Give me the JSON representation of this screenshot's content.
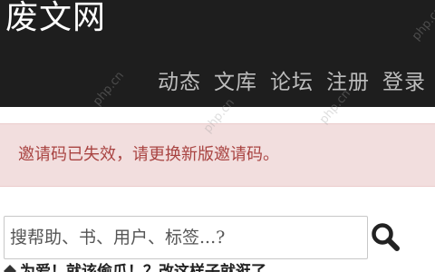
{
  "header": {
    "site_title": "废文网",
    "nav": [
      {
        "label": "动态"
      },
      {
        "label": "文库"
      },
      {
        "label": "论坛"
      },
      {
        "label": "注册"
      },
      {
        "label": "登录"
      }
    ]
  },
  "alert": {
    "message": "邀请码已失效，请更换新版邀请码。"
  },
  "search": {
    "placeholder": "搜帮助、书、用户、标签...?",
    "button_icon": "search-icon"
  },
  "content_peek": {
    "icon": "diamond-icon",
    "text": "为爱！就该偷瓜！？改这样子就逛了"
  },
  "watermark": {
    "text": "php.cn"
  },
  "colors": {
    "header_bg": "#1e1e1e",
    "nav_text": "#bdbdbd",
    "alert_bg": "#f2dede",
    "alert_text": "#a94442"
  }
}
